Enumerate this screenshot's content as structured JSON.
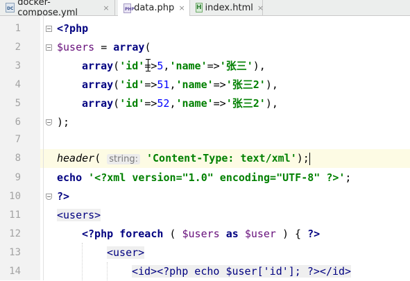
{
  "tabs": [
    {
      "label": "docker-compose.yml",
      "icon": "docker-compose-file-icon",
      "badge": "DC"
    },
    {
      "label": "data.php",
      "icon": "php-file-icon",
      "badge": "PHP"
    },
    {
      "label": "index.html",
      "icon": "html-file-icon",
      "badge": "H"
    }
  ],
  "close_glyph": "×",
  "line_numbers": [
    "1",
    "2",
    "3",
    "4",
    "5",
    "6",
    "7",
    "8",
    "9",
    "10",
    "11",
    "12",
    "13",
    "14"
  ],
  "code": {
    "l1": {
      "t1": "<?php"
    },
    "l2": {
      "t1": "$users",
      "t2": " = ",
      "t3": "array",
      "t4": "("
    },
    "l3": {
      "t1": "array",
      "t2": "(",
      "t3": "'id'",
      "t4": "=>",
      "t5": "5",
      "t6": ",",
      "t7": "'name'",
      "t8": "=>",
      "t9": "'张三'",
      "t10": "),"
    },
    "l4": {
      "t1": "array",
      "t2": "(",
      "t3": "'id'",
      "t4": "=>",
      "t5": "51",
      "t6": ",",
      "t7": "'name'",
      "t8": "=>",
      "t9": "'张三2'",
      "t10": "),"
    },
    "l5": {
      "t1": "array",
      "t2": "(",
      "t3": "'id'",
      "t4": "=>",
      "t5": "52",
      "t6": ",",
      "t7": "'name'",
      "t8": "=>",
      "t9": "'张三2'",
      "t10": "),"
    },
    "l6": {
      "t1": ");"
    },
    "l8": {
      "t1": "header",
      "t2": "( ",
      "hint": "string:",
      "t3": " ",
      "t4": "'Content-Type: text/xml'",
      "t5": ");"
    },
    "l9": {
      "t1": "echo",
      "t2": " ",
      "t3": "'<?xml version=\"1.0\" encoding=\"UTF-8\" ?>'",
      "t4": ";"
    },
    "l10": {
      "t1": "?>"
    },
    "l11": {
      "t1": "<users>"
    },
    "l12": {
      "t1": "<?php",
      "t2": " ",
      "t3": "foreach",
      "t4": " ( ",
      "t5": "$users",
      "t6": " ",
      "t7": "as",
      "t8": " ",
      "t9": "$user",
      "t10": " ) { ",
      "t11": "?>"
    },
    "l13": {
      "t1": "<user>"
    },
    "l14": {
      "t1": "<id><?php echo $user['id']; ?></id>"
    }
  },
  "colors": {
    "keyword": "#000080",
    "variable": "#660e7a",
    "string": "#008000",
    "number": "#0000ff",
    "current_line": "#fdfbe4",
    "gutter": "#f2f2f2"
  }
}
